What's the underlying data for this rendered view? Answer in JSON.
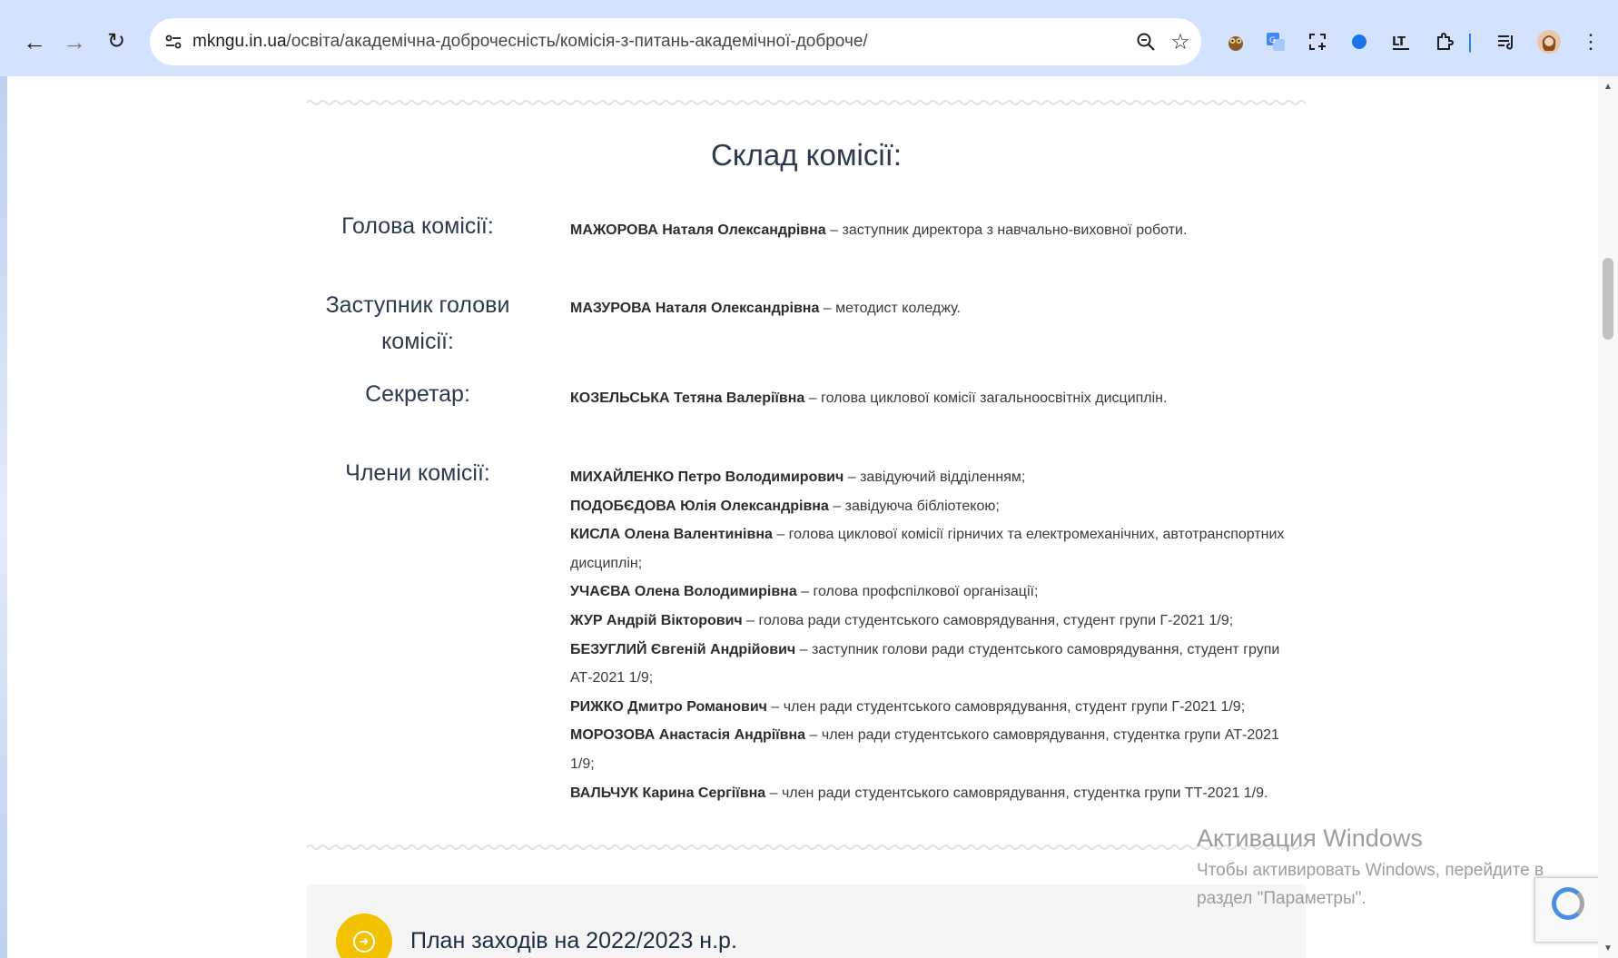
{
  "browser": {
    "url_host": "mkngu.in.ua",
    "url_path": "/освіта/академічна-доброчесність/комісія-з-питань-академічної-доброче/"
  },
  "commission": {
    "title": "Склад комісії:",
    "roles": [
      {
        "label": "Голова комісії:",
        "lines": [
          {
            "name": "МАЖОРОВА Наталя Олександрівна",
            "desc": " – заступник директора з навчально-виховної роботи."
          }
        ]
      },
      {
        "label": "Заступник голови комісії:",
        "lines": [
          {
            "name": "МАЗУРОВА Наталя Олександрівна",
            "desc": " – методист коледжу."
          }
        ]
      },
      {
        "label": "Секретар:",
        "lines": [
          {
            "name": "КОЗЕЛЬСЬКА Тетяна Валеріївна",
            "desc": " – голова циклової комісії загальноосвітніх дисциплін."
          }
        ]
      },
      {
        "label": "Члени комісії:",
        "lines": [
          {
            "name": "МИХАЙЛЕНКО Петро Володимирович",
            "desc": " – завідуючий відділенням;"
          },
          {
            "name": "ПОДОБЄДОВА Юлія Олександрівна",
            "desc": " – завідуюча бібліотекою;"
          },
          {
            "name": "КИСЛА Олена Валентинівна",
            "desc": " – голова циклової комісії гірничих та електромеханічних, автотранспортних дисциплін;"
          },
          {
            "name": "УЧАЄВА Олена Володимирівна",
            "desc": " – голова профспілкової організації;"
          },
          {
            "name": "ЖУР Андрій Вікторович",
            "desc": " – голова ради студентського самоврядування, студент групи Г-2021 1/9;"
          },
          {
            "name": "БЕЗУГЛИЙ Євгеній Андрійович",
            "desc": " – заступник голови ради студентського самоврядування, студент групи АТ-2021 1/9;"
          },
          {
            "name": "РИЖКО Дмитро Романович",
            "desc": " – член ради студентського самоврядування, студент групи Г-2021 1/9;"
          },
          {
            "name": "МОРОЗОВА Анастасія Андріївна",
            "desc": " – член ради студентського самоврядування, студентка групи АТ-2021 1/9;"
          },
          {
            "name": "ВАЛЬЧУК Карина Сергіївна",
            "desc": " – член ради студентського самоврядування, студентка групи ТТ-2021 1/9."
          }
        ]
      }
    ]
  },
  "plan_card": {
    "title": "План заходів на 2022/2023 н.р."
  },
  "watermark": {
    "title": "Активация Windows",
    "line1": "Чтобы активировать Windows, перейдите в",
    "line2": "раздел \"Параметры\"."
  },
  "colors": {
    "chrome_bg": "#d3e3fd",
    "accent_yellow": "#f2c200",
    "heading": "#2c3a4e"
  }
}
